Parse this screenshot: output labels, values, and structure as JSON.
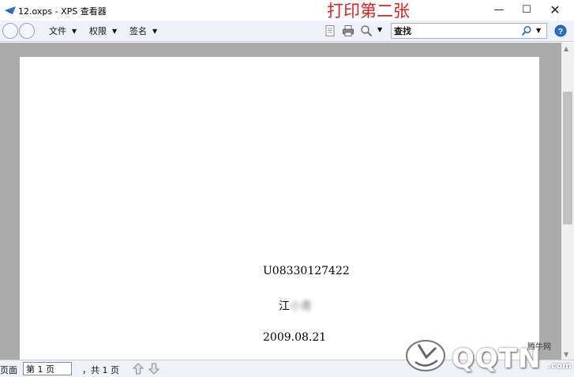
{
  "window": {
    "title": "12.oxps - XPS 查看器",
    "controls": {
      "minimize": "—",
      "maximize": "☐",
      "close": "✕"
    }
  },
  "annotation": {
    "text": "打印第二张",
    "color": "#e02020"
  },
  "toolbar": {
    "menus": [
      {
        "label": "文件"
      },
      {
        "label": "权限"
      },
      {
        "label": "签名"
      }
    ],
    "caret": "▼",
    "search": {
      "value": "查找"
    }
  },
  "document": {
    "lines": [
      "U08330127422",
      "江",
      "2009.08.21"
    ],
    "blurred_name": "小青"
  },
  "statusbar": {
    "page_label": "页面",
    "page_value": "第 1 页",
    "page_total": "，共 1 页"
  },
  "watermark": {
    "brand": "QQTN",
    "small": "腾牛网",
    "suffix": ".com"
  },
  "colors": {
    "toolbar_bg": "#eef1f7",
    "viewer_bg": "#ababab",
    "page_bg": "#ffffff",
    "accent_blue": "#2a6fc9"
  },
  "icons": [
    "app-icon",
    "back-forward-icon",
    "document-icon",
    "print-icon",
    "zoom-icon",
    "search-icon",
    "help-icon",
    "arrow-up-icon",
    "arrow-down-icon"
  ]
}
